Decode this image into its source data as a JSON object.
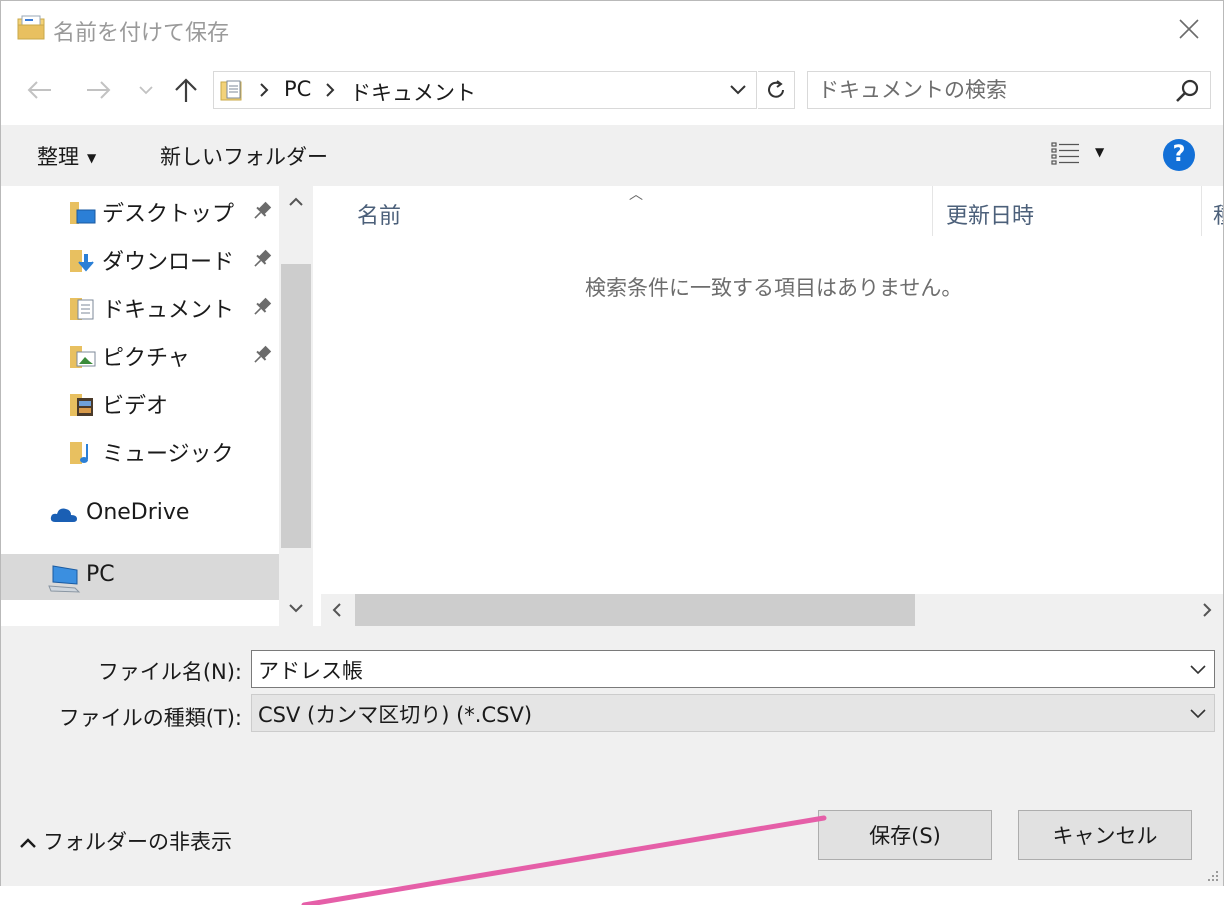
{
  "window": {
    "title": "名前を付けて保存"
  },
  "navigation": {
    "breadcrumb": [
      "PC",
      "ドキュメント"
    ],
    "search_placeholder": "ドキュメントの検索"
  },
  "toolbar": {
    "organize_label": "整理",
    "new_folder_label": "新しいフォルダー",
    "help_label": "?"
  },
  "sidebar": {
    "items": [
      {
        "label": "デスクトップ",
        "icon": "desktop-folder-icon",
        "pinned": true
      },
      {
        "label": "ダウンロード",
        "icon": "downloads-folder-icon",
        "pinned": true
      },
      {
        "label": "ドキュメント",
        "icon": "documents-folder-icon",
        "pinned": true
      },
      {
        "label": "ピクチャ",
        "icon": "pictures-folder-icon",
        "pinned": true
      },
      {
        "label": "ビデオ",
        "icon": "videos-folder-icon",
        "pinned": false
      },
      {
        "label": "ミュージック",
        "icon": "music-folder-icon",
        "pinned": false
      },
      {
        "label": "OneDrive",
        "icon": "onedrive-icon",
        "pinned": false
      },
      {
        "label": "PC",
        "icon": "pc-icon",
        "pinned": false,
        "selected": true
      }
    ]
  },
  "file_list": {
    "columns": [
      "名前",
      "更新日時",
      "種"
    ],
    "empty_message": "検索条件に一致する項目はありません。"
  },
  "form": {
    "filename_label": "ファイル名(N):",
    "filename_value": "アドレス帳",
    "filetype_label": "ファイルの種類(T):",
    "filetype_value": "CSV (カンマ区切り) (*.CSV)"
  },
  "footer": {
    "hide_folders_label": "フォルダーの非表示",
    "save_label": "保存(S)",
    "cancel_label": "キャンセル"
  },
  "colors": {
    "accent": "#1370d7",
    "annotation_line": "#e55fa8"
  }
}
